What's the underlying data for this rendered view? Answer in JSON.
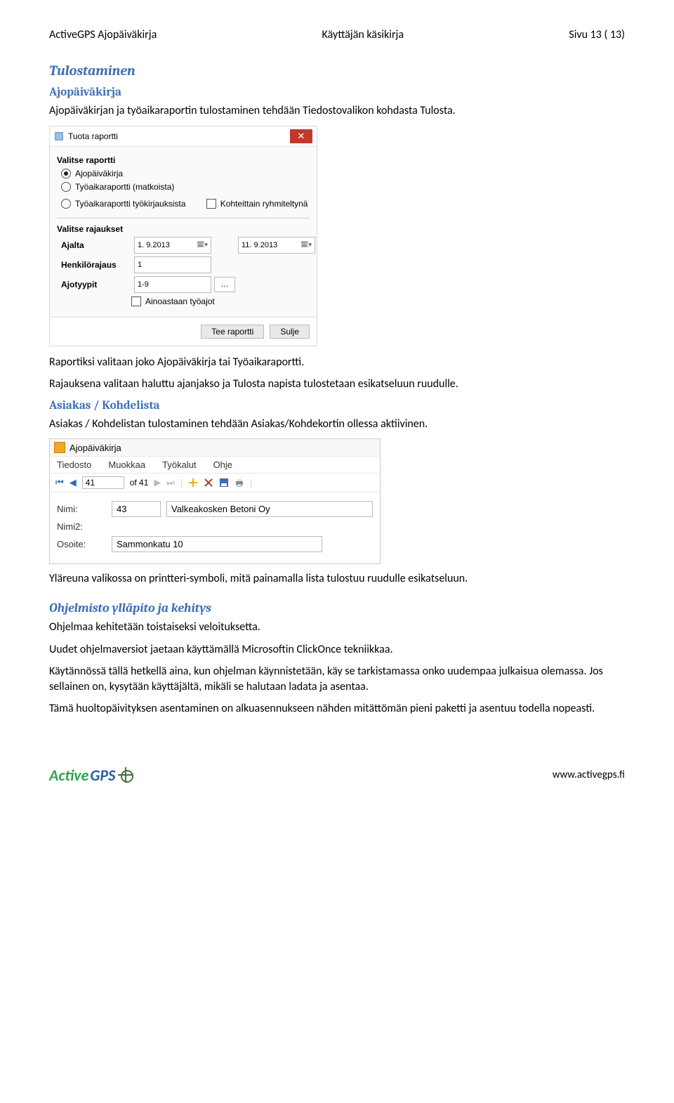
{
  "header": {
    "left": "ActiveGPS Ajopäiväkirja",
    "center": "Käyttäjän käsikirja",
    "right": "Sivu 13 ( 13)"
  },
  "section1_title": "Tulostaminen",
  "sub_ajo": "Ajopäiväkirja",
  "p1": "Ajopäiväkirjan ja työaikaraportin tulostaminen tehdään Tiedostovalikon kohdasta Tulosta.",
  "dialog": {
    "title": "Tuota raportti",
    "group1": "Valitse raportti",
    "radio1": "Ajopäiväkirja",
    "radio2": "Työaikaraportti (matkoista)",
    "radio3": "Työaikaraportti työkirjauksista",
    "check_kohteittain": "Kohteittain ryhmiteltynä",
    "group2": "Valitse rajaukset",
    "lbl_ajalta": "Ajalta",
    "date_from": "1. 9.2013",
    "date_to": "11. 9.2013",
    "lbl_henkilo": "Henkilörajaus",
    "val_henkilo": "1",
    "lbl_ajotyypit": "Ajotyypit",
    "val_ajotyypit": "1-9",
    "check_ainoastaan": "Ainoastaan työajot",
    "btn_tee": "Tee raportti",
    "btn_sulje": "Sulje"
  },
  "p2": "Raportiksi valitaan joko Ajopäiväkirja tai Työaikaraportti.",
  "p3": "Rajauksena valitaan haluttu ajanjakso ja Tulosta napista tulostetaan esikatseluun ruudulle.",
  "sub_asiakas": "Asiakas / Kohdelista",
  "p4": "Asiakas / Kohdelistan tulostaminen tehdään Asiakas/Kohdekortin ollessa aktiivinen.",
  "app": {
    "title": "Ajopäiväkirja",
    "menu": {
      "tiedosto": "Tiedosto",
      "muokkaa": "Muokkaa",
      "tyokalut": "Työkalut",
      "ohje": "Ohje"
    },
    "nav": {
      "current": "41",
      "of_label": "of 41"
    },
    "lbl_nimi": "Nimi:",
    "val_id": "43",
    "val_nimi": "Valkeakosken Betoni Oy",
    "lbl_nimi2": "Nimi2:",
    "lbl_osoite": "Osoite:",
    "val_osoite": "Sammonkatu 10"
  },
  "p5": "Yläreuna valikossa on printteri-symboli, mitä painamalla lista tulostuu ruudulle esikatseluun.",
  "sub_ohjelmisto": "Ohjelmisto ylläpito ja kehitys",
  "p6": "Ohjelmaa kehitetään toistaiseksi veloituksetta.",
  "p7": "Uudet ohjelmaversiot jaetaan käyttämällä Microsoftin ClickOnce tekniikkaa.",
  "p8": "Käytännössä tällä hetkellä aina, kun ohjelman käynnistetään, käy se tarkistamassa onko uudempaa julkaisua olemassa. Jos sellainen on, kysytään käyttäjältä, mikäli se halutaan ladata ja asentaa.",
  "p9": "Tämä huoltopäivityksen asentaminen on alkuasennukseen nähden mitättömän pieni paketti ja asentuu todella nopeasti.",
  "footer": {
    "logo_active": "Active",
    "logo_gps": "GPS",
    "url": "www.activegps.fi"
  }
}
